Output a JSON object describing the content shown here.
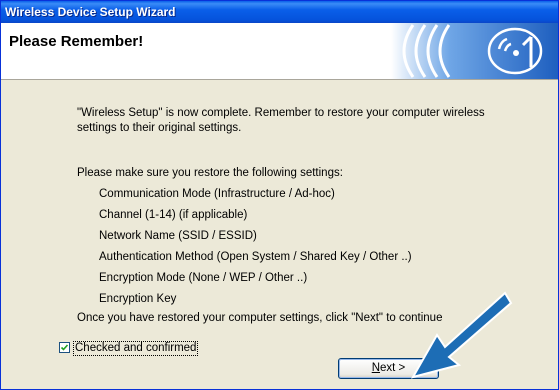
{
  "window": {
    "title": "Wireless Device Setup Wizard"
  },
  "header": {
    "title": "Please Remember!",
    "logo_icon": "wireless-signal-icon"
  },
  "content": {
    "intro_line1": "\"Wireless Setup\" is now complete. Remember to restore your computer wireless",
    "intro_line2": "settings to their original settings.",
    "restore_heading": "Please make sure you restore the following settings:",
    "settings": [
      "Communication Mode (Infrastructure / Ad-hoc)",
      "Channel (1-14) (if applicable)",
      "Network Name (SSID / ESSID)",
      "Authentication Method (Open System / Shared Key / Other ..)",
      "Encryption Mode (None / WEP / Other ..)",
      "Encryption Key"
    ],
    "closing": "Once you have restored your computer settings, click \"Next\" to continue"
  },
  "checkbox": {
    "label": "Checked and confirmed",
    "checked": true
  },
  "buttons": {
    "next_prefix": "N",
    "next_rest": "ext >"
  },
  "colors": {
    "titlebar": "#0a5fe9",
    "dialog_bg": "#ece9d8",
    "arrow": "#1d6db5"
  }
}
